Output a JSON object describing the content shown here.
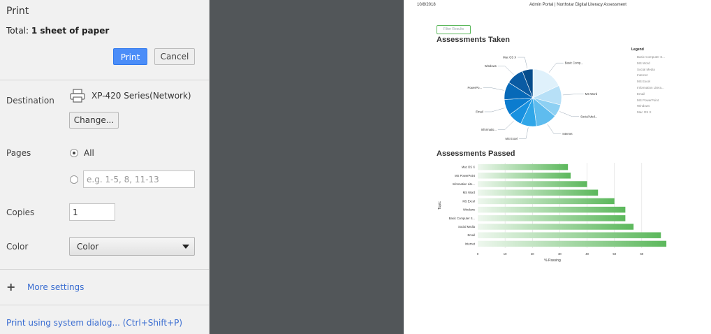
{
  "panel": {
    "title": "Print",
    "total_prefix": "Total: ",
    "total_value": "1 sheet of paper",
    "print_label": "Print",
    "cancel_label": "Cancel",
    "destination_label": "Destination",
    "destination_name": "XP-420 Series(Network)",
    "change_label": "Change...",
    "pages_label": "Pages",
    "pages_all_label": "All",
    "pages_placeholder": "e.g. 1-5, 8, 11-13",
    "copies_label": "Copies",
    "copies_value": "1",
    "color_label": "Color",
    "color_value": "Color",
    "more_settings": "More settings",
    "system_dialog": "Print using system dialog... (Ctrl+Shift+P)"
  },
  "page": {
    "date": "10/8/2018",
    "header": "Admin Portal | Northstar Digital Literacy Assessment",
    "filter_button": "Filter Results",
    "pie_title": "Assessments Taken",
    "bar_title": "Assessments Passed",
    "legend_title": "Legend",
    "legend_items": [
      "Basic Computer S...",
      "MS Word",
      "Social Media",
      "Internet",
      "MS Excel",
      "Information Litera...",
      "Email",
      "MS PowerPoint",
      "Windows",
      "Mac OS X"
    ]
  },
  "chart_data": [
    {
      "type": "pie",
      "title": "Assessments Taken",
      "slices": [
        {
          "label": "Basic Comp...",
          "value": 18,
          "color": "#dff1fb"
        },
        {
          "label": "MS Word",
          "value": 11,
          "color": "#b7e0f7"
        },
        {
          "label": "Social Med...",
          "value": 7,
          "color": "#8dd0f3"
        },
        {
          "label": "Internet",
          "value": 12,
          "color": "#5fbcee"
        },
        {
          "label": "MS Excel",
          "value": 9,
          "color": "#30a6e8"
        },
        {
          "label": "Informatio...",
          "value": 8,
          "color": "#1891e0"
        },
        {
          "label": "Email",
          "value": 9,
          "color": "#0b7ccf"
        },
        {
          "label": "MS PowerPo...",
          "value": 10,
          "color": "#0769b8"
        },
        {
          "label": "Windows",
          "value": 10,
          "color": "#0a5ba3"
        },
        {
          "label": "Mac OS X",
          "value": 6,
          "color": "#064d8c"
        }
      ]
    },
    {
      "type": "bar",
      "orientation": "horizontal",
      "title": "Assessments Passed",
      "xlabel": "% Passing",
      "ylabel": "Topic",
      "xlim": [
        0,
        70
      ],
      "xticks": [
        0,
        10,
        20,
        30,
        40,
        50,
        60
      ],
      "categories": [
        "Mac OS X",
        "MS PowerPoint",
        "Information Lite...",
        "MS Word",
        "MS Excel",
        "Windows",
        "Basic Computer S...",
        "Social Media",
        "Email",
        "Internet"
      ],
      "values": [
        33,
        34,
        40,
        44,
        50,
        54,
        54,
        57,
        67,
        69
      ],
      "color": "#5cb85c"
    }
  ]
}
